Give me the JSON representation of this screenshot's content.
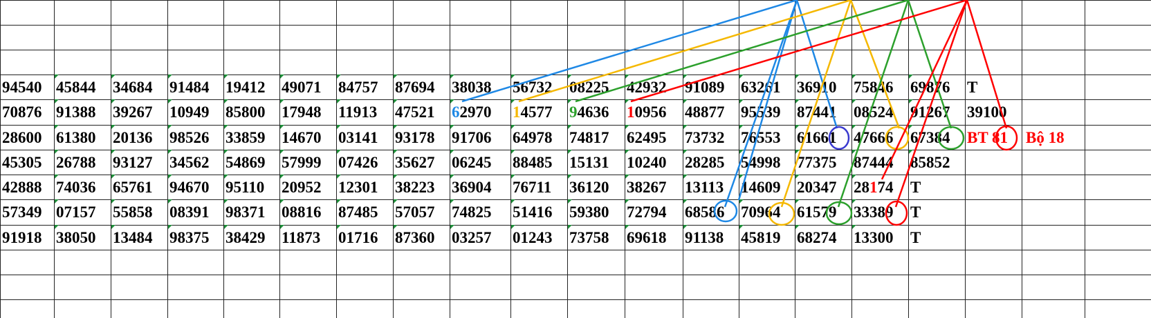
{
  "rows": [
    [
      "94540",
      "45844",
      "34684",
      "91484",
      "19412",
      "49071",
      "84757",
      "87694",
      "38038",
      "56732",
      "08225",
      "42932",
      "91089",
      "63261",
      "36910",
      "75846",
      "69876",
      "T"
    ],
    [
      "70876",
      "91388",
      "39267",
      "10949",
      "85800",
      "17948",
      "11913",
      "47521",
      "62970",
      "14577",
      "94636",
      "10956",
      "48877",
      "95539",
      "87441",
      "08524",
      "91267",
      "39100"
    ],
    [
      "28600",
      "61380",
      "20136",
      "98526",
      "33859",
      "14670",
      "03141",
      "93178",
      "91706",
      "64978",
      "74817",
      "62495",
      "73732",
      "76553",
      "61661",
      "47666",
      "67384",
      "BT 81",
      "Bộ 18"
    ],
    [
      "45305",
      "26788",
      "93127",
      "34562",
      "54869",
      "57999",
      "07426",
      "35627",
      "06245",
      "88485",
      "15131",
      "10240",
      "28285",
      "54998",
      "77375",
      "87444",
      "85852"
    ],
    [
      "42888",
      "74036",
      "65761",
      "94670",
      "95110",
      "20952",
      "12301",
      "38223",
      "36904",
      "76711",
      "36120",
      "38267",
      "13113",
      "14609",
      "20347",
      "28174",
      "T"
    ],
    [
      "57349",
      "07157",
      "55858",
      "08391",
      "98371",
      "08816",
      "87485",
      "57057",
      "74825",
      "51416",
      "59380",
      "72794",
      "68586",
      "70964",
      "61579",
      "33389",
      "T"
    ],
    [
      "91918",
      "38050",
      "13484",
      "98375",
      "38429",
      "11873",
      "01716",
      "87360",
      "03257",
      "01243",
      "73758",
      "69618",
      "91138",
      "45819",
      "68274",
      "13300",
      "T"
    ]
  ],
  "highlights": [
    {
      "row": 1,
      "col": 8,
      "digit": "6",
      "color": "#1e88e5"
    },
    {
      "row": 1,
      "col": 9,
      "digit": "1",
      "color": "#f5b800"
    },
    {
      "row": 1,
      "col": 10,
      "digit": "9",
      "color": "#2ca02c"
    },
    {
      "row": 1,
      "col": 11,
      "digit": "1",
      "color": "#ff0000"
    },
    {
      "row": 4,
      "col": 15,
      "digit": "1",
      "color": "#ff0000"
    }
  ],
  "colors": {
    "blue": "#1e88e5",
    "yellow": "#f5b800",
    "green": "#2ca02c",
    "red": "#ff0000",
    "navy": "#3a3acf",
    "grid": "#222222"
  }
}
